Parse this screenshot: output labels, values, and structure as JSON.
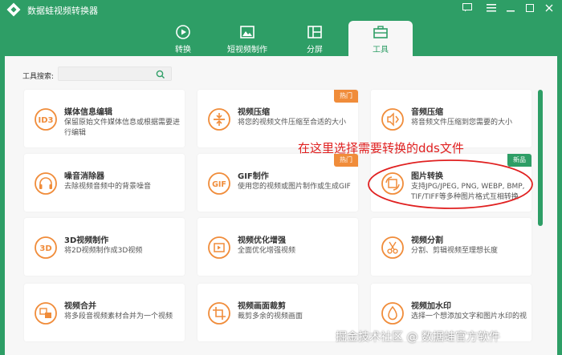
{
  "app": {
    "title": "数据蛙视频转换器"
  },
  "window_controls": [
    "feedback-icon",
    "menu-icon",
    "minimize-icon",
    "maximize-icon",
    "close-icon"
  ],
  "tabs": [
    {
      "label": "转换",
      "icon": "convert-icon",
      "active": false
    },
    {
      "label": "短视频制作",
      "icon": "short-video-icon",
      "active": false
    },
    {
      "label": "分屏",
      "icon": "split-screen-icon",
      "active": false
    },
    {
      "label": "工具",
      "icon": "toolbox-icon",
      "active": true
    }
  ],
  "search": {
    "label": "工具搜索:",
    "placeholder": ""
  },
  "tools": [
    {
      "icon": "ID3",
      "title": "媒体信息编辑",
      "desc": "保留原始文件媒体信息或根据需要进行编辑",
      "badge": ""
    },
    {
      "icon": "compress-icon",
      "title": "视频压缩",
      "desc": "将您的视频文件压缩至合适的大小",
      "badge": "热门"
    },
    {
      "icon": "audio-compress-icon",
      "title": "音频压缩",
      "desc": "将音频文件压缩到您需要的大小",
      "badge": ""
    },
    {
      "icon": "headphones-icon",
      "title": "噪音消除器",
      "desc": "去除视频音频中的背景噪音",
      "badge": ""
    },
    {
      "icon": "GIF",
      "title": "GIF制作",
      "desc": "使用您的视频或图片制作或生成GIF",
      "badge": "热门"
    },
    {
      "icon": "image-convert-icon",
      "title": "图片转换",
      "desc": "支持JPG/JPEG, PNG, WEBP, BMP, TIF/TIFF等多种图片格式互相转换",
      "badge": "新品"
    },
    {
      "icon": "3D",
      "title": "3D视频制作",
      "desc": "将2D视频制作成3D视频",
      "badge": ""
    },
    {
      "icon": "enhance-icon",
      "title": "视频优化增强",
      "desc": "全面优化增强视频",
      "badge": ""
    },
    {
      "icon": "scissors-icon",
      "title": "视频分割",
      "desc": "分割、剪辑视频至理想长度",
      "badge": ""
    },
    {
      "icon": "merge-icon",
      "title": "视频合并",
      "desc": "将多段音视频素材合并为一个视频",
      "badge": ""
    },
    {
      "icon": "crop-icon",
      "title": "视频画面裁剪",
      "desc": "裁剪多余的视频画面",
      "badge": ""
    },
    {
      "icon": "watermark-drop-icon",
      "title": "视频加水印",
      "desc": "选择一个想添加文字和图片水印的视",
      "badge": ""
    }
  ],
  "annotation": {
    "text": "在这里选择需要转换的dds文件"
  },
  "watermark": {
    "text": "掘金技术社区 @ 数据蛙官方软件"
  },
  "colors": {
    "brand_green": "#2e9e66",
    "hot_orange": "#f08c3a",
    "annotation_red": "#e02020",
    "icon_orange": "#f08c3a"
  }
}
